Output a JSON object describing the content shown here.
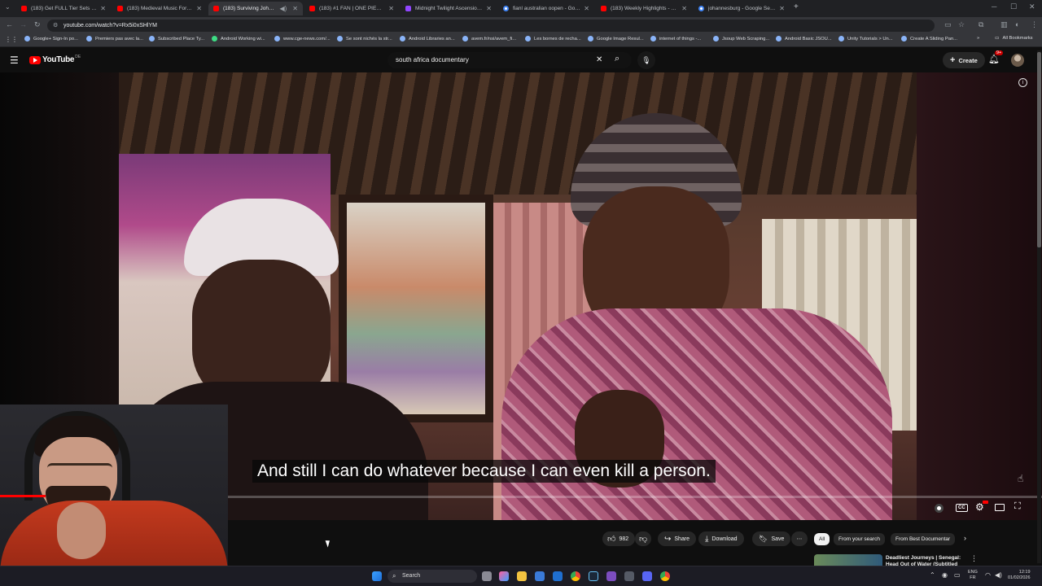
{
  "browser": {
    "tabs": [
      {
        "title": "(183) Get FULL Tier Sets FAST fr",
        "fav": "youtube"
      },
      {
        "title": "(183) Medieval Music For Focus",
        "fav": "youtube"
      },
      {
        "title": "(183) Surviving Johannesb",
        "fav": "youtube",
        "active": true
      },
      {
        "title": "(183) #1 FAN | ONE PIECE | Rea",
        "fav": "youtube"
      },
      {
        "title": "Midnight Twilight Ascension Pe",
        "fav": "twitch"
      },
      {
        "title": "fianl australian oopen - Google",
        "fav": "google"
      },
      {
        "title": "(183) Weekly Highlights - Highl",
        "fav": "youtube"
      },
      {
        "title": "johannesburg - Google Search",
        "fav": "google"
      }
    ],
    "new_tab": "+",
    "url": "youtube.com/watch?v=Rx5i0xSHlYM",
    "bookmarks": [
      "Google+ Sign-In po...",
      "Premiers pas avec la...",
      "Subscribed Place Ty...",
      "Android Working wi...",
      "www.cge-news.com/...",
      "Se sont nichés la str...",
      "Android Libraries an...",
      "avem.fr/nsi/avem_fi...",
      "Les bornes de recha...",
      "Google Image Resul...",
      "internet of things -...",
      "Jsoup Web Scraping...",
      "Android Basic JSOU...",
      "Unity Tutorials > Un...",
      "Create A Sliding Pan..."
    ],
    "all_bookmarks": "All Bookmarks"
  },
  "youtube": {
    "logo_text": "YouTube",
    "region": "DE",
    "search_query": "south africa documentary",
    "create_label": "Create",
    "notif_badge": "9+"
  },
  "video": {
    "subtitle": "And still I can do whatever because I can even kill a person.",
    "progress": 0.045
  },
  "actions": {
    "likes": "982",
    "share": "Share",
    "download": "Download",
    "save": "Save"
  },
  "filter_chips": [
    "All",
    "From your search",
    "From Best Documentar"
  ],
  "recommended": {
    "title": "Deadliest Journeys | Senegal: Head Out of Water (Subtitled"
  },
  "taskbar": {
    "search": "Search",
    "lang_top": "ENG",
    "lang_bottom": "FR",
    "time": "12:19",
    "date": "01/02/2026"
  },
  "colors": {
    "youtube_red": "#ff0000",
    "progress_red": "#ff0000",
    "page_bg": "#0f0f0f"
  }
}
